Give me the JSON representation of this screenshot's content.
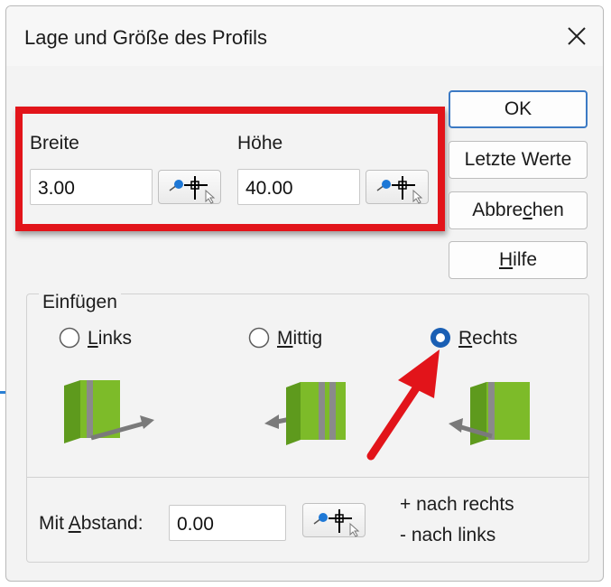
{
  "dialog": {
    "title": "Lage und Größe des Profils",
    "close_icon": "close-icon"
  },
  "size": {
    "width_label": "Breite",
    "width_value": "3.00",
    "height_label": "Höhe",
    "height_value": "40.00",
    "picker_icon": "pin-crosshair-icon"
  },
  "buttons": {
    "ok": "OK",
    "last_values": "Letzte Werte",
    "cancel_prefix": "Abbre",
    "cancel_hot": "c",
    "cancel_suffix": "hen",
    "help_hot": "H",
    "help_suffix": "ilfe"
  },
  "insert": {
    "group_label": "Einfügen",
    "options": [
      {
        "hot": "L",
        "rest": "inks",
        "selected": false
      },
      {
        "hot": "M",
        "rest": "ittig",
        "selected": false
      },
      {
        "hot": "R",
        "rest": "echts",
        "selected": true
      }
    ]
  },
  "offset": {
    "label_prefix": "Mit ",
    "label_hot": "A",
    "label_suffix": "bstand:",
    "value": "0.00",
    "hint_right": "+  nach rechts",
    "hint_left": "-  nach links"
  },
  "colors": {
    "highlight_red": "#e2141a",
    "profile_green": "#7dbb29",
    "accent_blue": "#1a5fb4"
  }
}
